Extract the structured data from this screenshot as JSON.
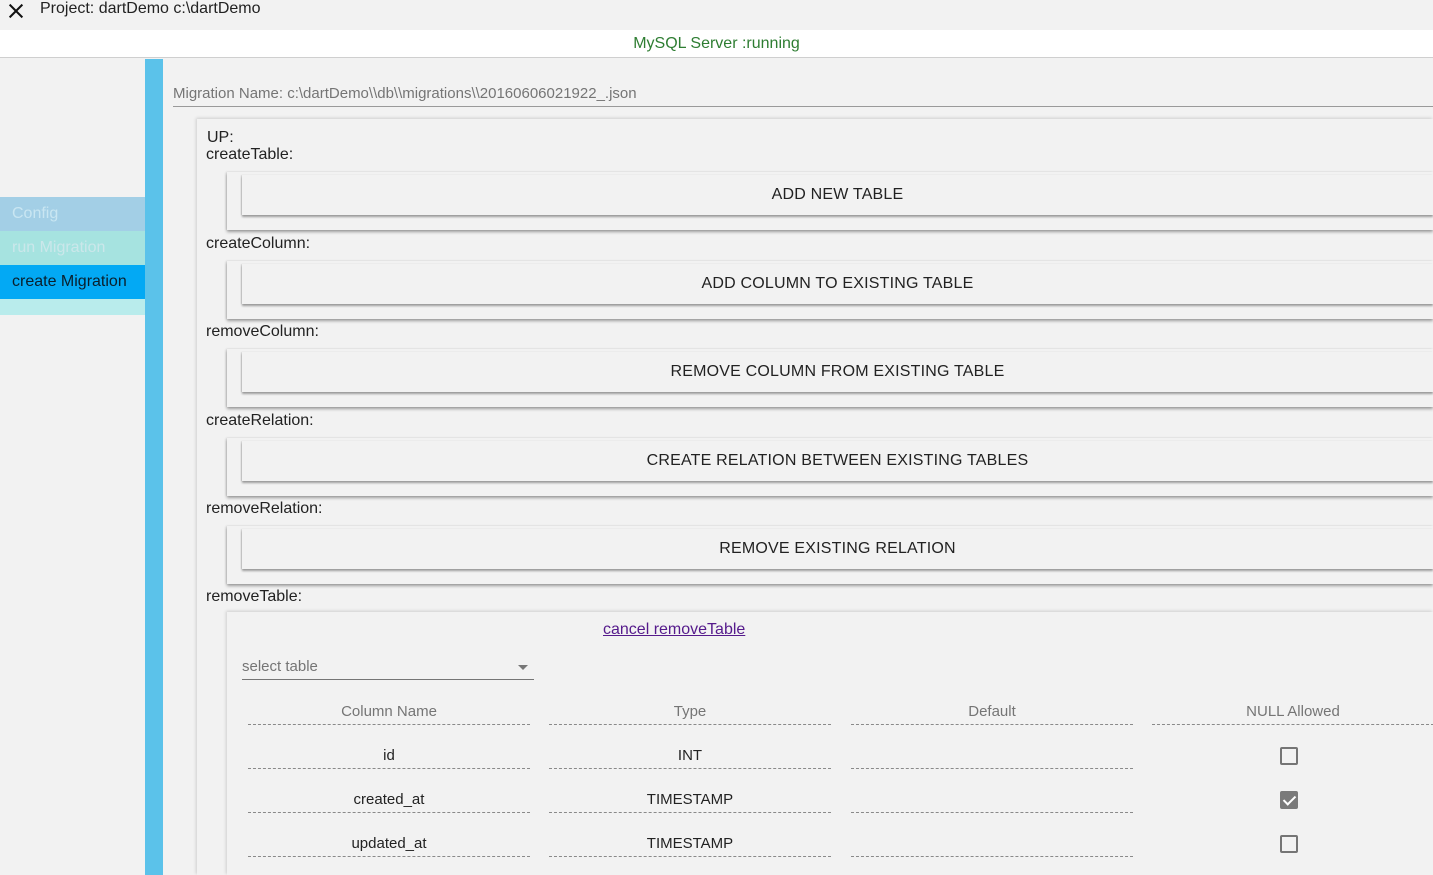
{
  "window": {
    "title": "Project: dartDemo c:\\dartDemo"
  },
  "status": {
    "text": "MySQL Server :running",
    "color": "#2e7d32"
  },
  "sidebar": {
    "items": [
      {
        "label": "Config"
      },
      {
        "label": "run Migration"
      },
      {
        "label": "create Migration"
      }
    ]
  },
  "migration": {
    "name_label": "Migration Name: c:\\dartDemo\\\\db\\\\migrations\\\\20160606021922_.json"
  },
  "up": {
    "label": "UP:",
    "sections": {
      "createTable": {
        "label": "createTable:",
        "button": "ADD NEW TABLE"
      },
      "createColumn": {
        "label": "createColumn:",
        "button": "ADD COLUMN TO EXISTING TABLE"
      },
      "removeColumn": {
        "label": "removeColumn:",
        "button": "REMOVE COLUMN FROM EXISTING TABLE"
      },
      "createRelation": {
        "label": "createRelation:",
        "button": "CREATE RELATION BETWEEN EXISTING TABLES"
      },
      "removeRelation": {
        "label": "removeRelation:",
        "button": "REMOVE EXISTING RELATION"
      },
      "removeTable": {
        "label": "removeTable:"
      }
    }
  },
  "removeTable": {
    "cancel_link": "cancel removeTable",
    "select_placeholder": "select table",
    "columns": [
      "Column Name",
      "Type",
      "Default",
      "NULL Allowed"
    ],
    "rows": [
      {
        "name": "id",
        "type": "INT",
        "default": "",
        "null_allowed": false
      },
      {
        "name": "created_at",
        "type": "TIMESTAMP",
        "default": "",
        "null_allowed": true
      },
      {
        "name": "updated_at",
        "type": "TIMESTAMP",
        "default": "",
        "null_allowed": false
      }
    ]
  }
}
